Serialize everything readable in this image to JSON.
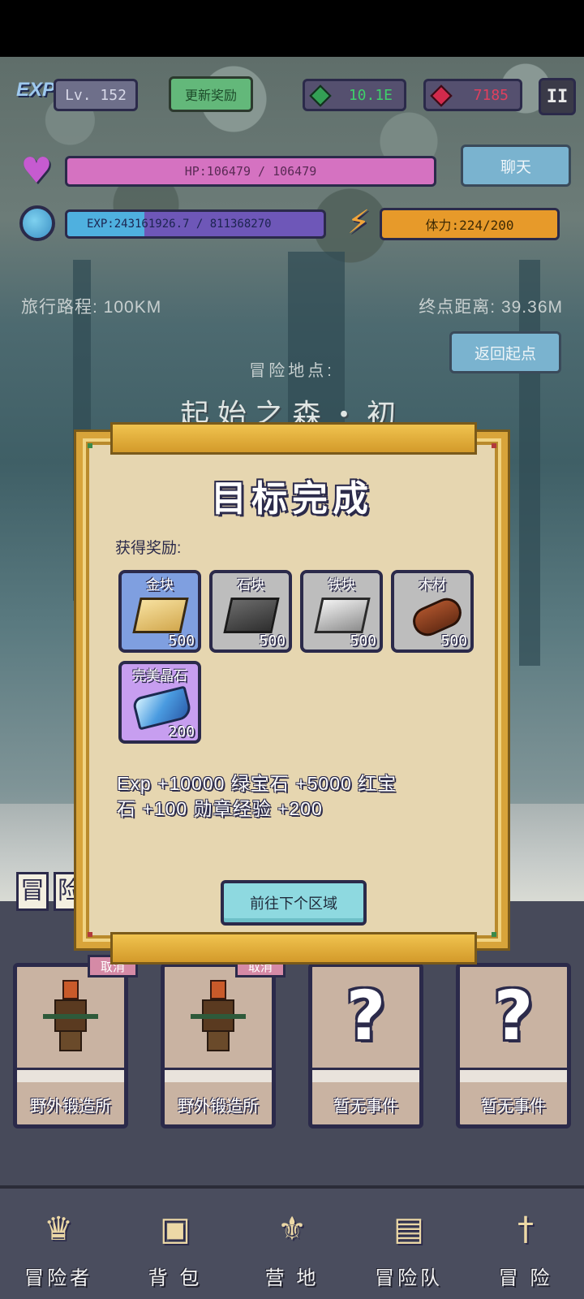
{
  "hud": {
    "exp_logo": "EXP",
    "level": "Lv. 152",
    "refresh_label": "更新奖励",
    "emerald": "10.1E",
    "ruby": "7185",
    "pause": "II",
    "hp": "HP:106479 / 106479",
    "chat_label": "聊天",
    "exp": "EXP:243161926.7 / 811368270",
    "exp_fraction": 0.3,
    "stamina": "体力:224/200"
  },
  "travel": {
    "distance_traveled": "旅行路程: 100KM",
    "distance_remaining": "终点距离: 39.36M",
    "return_label": "返回起点",
    "location_label": "冒险地点:",
    "location_name": "起始之森・初"
  },
  "modal": {
    "title": "目标完成",
    "rewards_label": "获得奖励:",
    "items": [
      {
        "name": "金块",
        "qty": "500",
        "icon": "gold-block-icon",
        "rarity_color": "#7f9fe0"
      },
      {
        "name": "石块",
        "qty": "500",
        "icon": "stone-block-icon",
        "rarity_color": "#bdbdbd"
      },
      {
        "name": "铁块",
        "qty": "500",
        "icon": "iron-block-icon",
        "rarity_color": "#bdbdbd"
      },
      {
        "name": "木材",
        "qty": "500",
        "icon": "wood-log-icon",
        "rarity_color": "#bdbdbd"
      },
      {
        "name": "完美晶石",
        "qty": "200",
        "icon": "perfect-crystal-icon",
        "rarity_color": "#c79ef0"
      }
    ],
    "reward_line1": "Exp +10000  绿宝石 +5000  红宝",
    "reward_line2": "石 +100  勋章经验 +200",
    "next_button": "前往下个区域"
  },
  "adventure_header": [
    "冒",
    "险"
  ],
  "event_cards": [
    {
      "label": "野外锻造所",
      "cancel": "取消",
      "icon": "blacksmith-icon"
    },
    {
      "label": "野外锻造所",
      "cancel": "取消",
      "icon": "blacksmith-icon"
    },
    {
      "label": "暂无事件",
      "icon": "question-mark-icon"
    },
    {
      "label": "暂无事件",
      "icon": "question-mark-icon"
    }
  ],
  "nav": [
    {
      "label": "冒险者",
      "icon": "adventurer-helmet-icon"
    },
    {
      "label": "背 包",
      "icon": "backpack-icon"
    },
    {
      "label": "营 地",
      "icon": "camp-banner-icon"
    },
    {
      "label": "冒险队",
      "icon": "team-book-icon"
    },
    {
      "label": "冒 险",
      "icon": "sword-icon"
    }
  ]
}
